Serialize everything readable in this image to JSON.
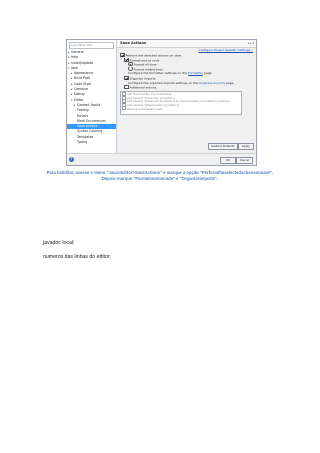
{
  "dialog": {
    "filter_placeholder": "type filter text",
    "tree": [
      {
        "label": "General",
        "depth": 0,
        "expanded": false
      },
      {
        "label": "Help",
        "depth": 0,
        "expanded": false
      },
      {
        "label": "Install/Update",
        "depth": 0,
        "expanded": false
      },
      {
        "label": "Java",
        "depth": 0,
        "expanded": true
      },
      {
        "label": "Appearance",
        "depth": 1,
        "expanded": false
      },
      {
        "label": "Build Path",
        "depth": 1,
        "expanded": false
      },
      {
        "label": "Code Style",
        "depth": 1,
        "expanded": false
      },
      {
        "label": "Compiler",
        "depth": 1,
        "expanded": false
      },
      {
        "label": "Debug",
        "depth": 1,
        "expanded": false
      },
      {
        "label": "Editor",
        "depth": 1,
        "expanded": true
      },
      {
        "label": "Content Assist",
        "depth": 2,
        "expanded": false
      },
      {
        "label": "Folding",
        "depth": 2,
        "expanded": null
      },
      {
        "label": "Hovers",
        "depth": 2,
        "expanded": null
      },
      {
        "label": "Mark Occurrences",
        "depth": 2,
        "expanded": null
      },
      {
        "label": "Save Actions",
        "depth": 2,
        "expanded": null,
        "selected": true
      },
      {
        "label": "Syntax Coloring",
        "depth": 2,
        "expanded": null
      },
      {
        "label": "Templates",
        "depth": 2,
        "expanded": null
      },
      {
        "label": "Typing",
        "depth": 2,
        "expanded": null
      }
    ],
    "header_title": "Save Actions",
    "project_link": "Configure Project Specific Settings...",
    "options": [
      {
        "kind": "checkbox",
        "checked": true,
        "indent": 1,
        "text": "Perform the selected actions on save"
      },
      {
        "kind": "checkbox",
        "checked": true,
        "indent": 2,
        "text": "Format source code"
      },
      {
        "kind": "radio",
        "checked": true,
        "indent": 3,
        "text": "Format all lines"
      },
      {
        "kind": "radio",
        "checked": false,
        "indent": 3,
        "text": "Format edited lines"
      },
      {
        "kind": "text",
        "indent": 3,
        "text_before": "Configure the formatter settings on the ",
        "link": "Formatter",
        "text_after": " page."
      },
      {
        "kind": "checkbox",
        "checked": true,
        "indent": 2,
        "text": "Organize imports"
      },
      {
        "kind": "text",
        "indent": 3,
        "text_before": "Configure the organize imports settings on the ",
        "link": "Organize Imports",
        "text_after": " page."
      },
      {
        "kind": "checkbox",
        "checked": false,
        "indent": 2,
        "text": "Additional actions"
      }
    ],
    "additional_actions": [
      "Add final modifier to private fields",
      "Add missing '@Override' annotations",
      "Add missing '@Override' annotations to implementations of interface methods",
      "Add missing '@Deprecated' annotations",
      "Remove unnecessary casts"
    ],
    "configure_button": "Configure...",
    "restore_button": "Restore Defaults",
    "apply_button": "Apply",
    "ok_button": "OK",
    "cancel_button": "Cancel"
  },
  "caption_line1": "Para habilitar, acesse o menu \"Java>Editor>SaveActions\" e marque a opção \"Performtheselectedactionsonsave\".",
  "caption_line2": "Depois marque \"Formatsourcecode\" e \"Organizeimports\".",
  "paragraphs": [
    "javadoc local;",
    "numeros das linhas do editor;"
  ]
}
